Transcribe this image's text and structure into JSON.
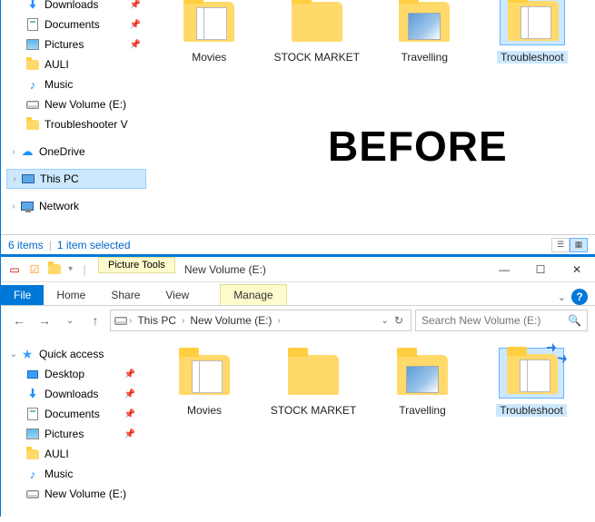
{
  "top": {
    "sidebar": [
      {
        "icon": "download",
        "label": "Downloads",
        "pin": true,
        "indent": true
      },
      {
        "icon": "document",
        "label": "Documents",
        "pin": true,
        "indent": true
      },
      {
        "icon": "picture",
        "label": "Pictures",
        "pin": true,
        "indent": true
      },
      {
        "icon": "folder",
        "label": "AULI",
        "pin": false,
        "indent": true
      },
      {
        "icon": "music",
        "label": "Music",
        "pin": false,
        "indent": true
      },
      {
        "icon": "drive",
        "label": "New Volume (E:)",
        "pin": false,
        "indent": true
      },
      {
        "icon": "folder",
        "label": "Troubleshooter V",
        "pin": false,
        "indent": true
      },
      {
        "icon": "cloud",
        "label": "OneDrive",
        "pin": false,
        "indent": false,
        "expandable": true
      },
      {
        "icon": "pc",
        "label": "This PC",
        "pin": false,
        "indent": false,
        "expandable": true,
        "selected": true
      },
      {
        "icon": "network",
        "label": "Network",
        "pin": false,
        "indent": false,
        "expandable": true
      }
    ],
    "items": [
      {
        "name": "Movies",
        "kind": "folder-preview",
        "selected": false
      },
      {
        "name": "STOCK MARKET",
        "kind": "folder",
        "selected": false
      },
      {
        "name": "Travelling",
        "kind": "folder-sky",
        "selected": false
      },
      {
        "name": "Troubleshoot",
        "kind": "folder-preview",
        "selected": true,
        "shared": false
      }
    ],
    "status": {
      "count": "6 items",
      "selected": "1 item selected"
    },
    "annotation": "BEFORE"
  },
  "bottom": {
    "qat": {
      "save_icon": "▢",
      "folder_icon": "📁"
    },
    "contextual": {
      "group": "Picture Tools",
      "tab": "Manage"
    },
    "title": "New Volume (E:)",
    "ribbon": [
      "File",
      "Home",
      "Share",
      "View"
    ],
    "breadcrumb": [
      "This PC",
      "New Volume (E:)"
    ],
    "search_placeholder": "Search New Volume (E:)",
    "sidebar": [
      {
        "icon": "star",
        "label": "Quick access",
        "indent": false,
        "expandable": true,
        "open": true
      },
      {
        "icon": "desktop",
        "label": "Desktop",
        "pin": true,
        "indent": true
      },
      {
        "icon": "download",
        "label": "Downloads",
        "pin": true,
        "indent": true
      },
      {
        "icon": "document",
        "label": "Documents",
        "pin": true,
        "indent": true
      },
      {
        "icon": "picture",
        "label": "Pictures",
        "pin": true,
        "indent": true
      },
      {
        "icon": "folder",
        "label": "AULI",
        "indent": true
      },
      {
        "icon": "music",
        "label": "Music",
        "indent": true
      },
      {
        "icon": "drive",
        "label": "New Volume (E:)",
        "indent": true
      }
    ],
    "items": [
      {
        "name": "Movies",
        "kind": "folder-preview",
        "selected": false
      },
      {
        "name": "STOCK MARKET",
        "kind": "folder",
        "selected": false
      },
      {
        "name": "Travelling",
        "kind": "folder-sky",
        "selected": false
      },
      {
        "name": "Troubleshoot",
        "kind": "folder-preview",
        "selected": true,
        "shared": true
      }
    ]
  }
}
